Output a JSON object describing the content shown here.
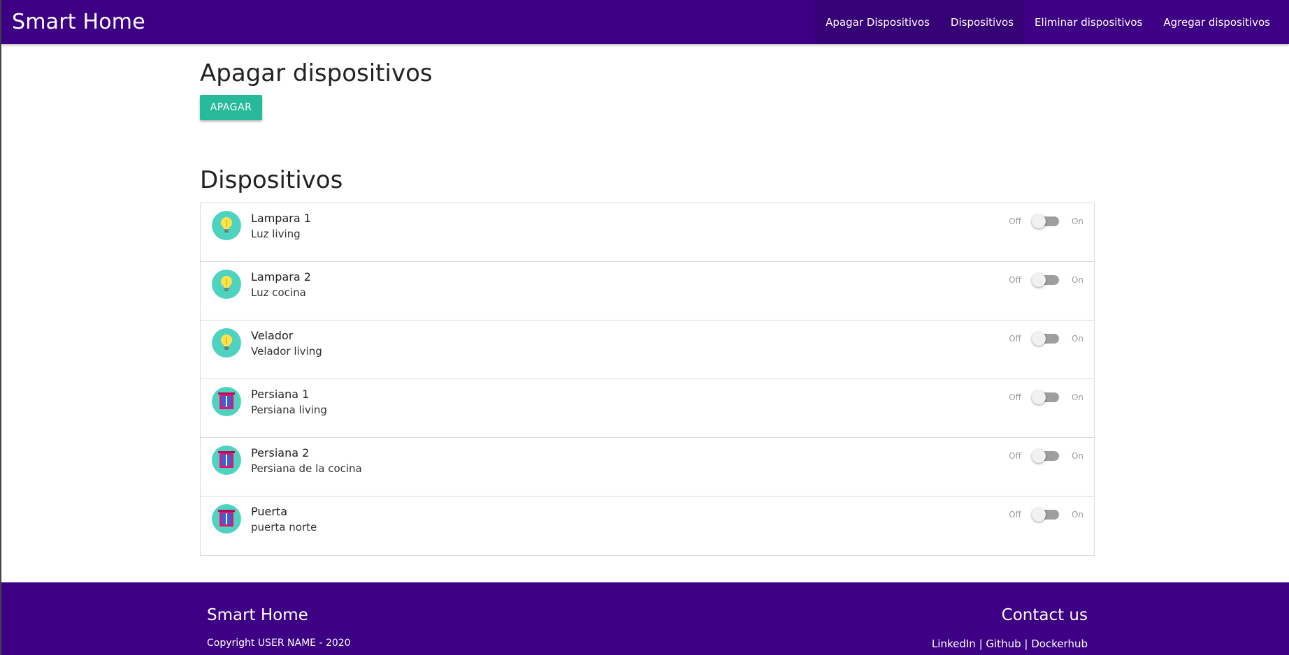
{
  "navbar": {
    "brand": "Smart Home",
    "links": [
      {
        "label": "Apagar Dispositivos"
      },
      {
        "label": "Dispositivos"
      },
      {
        "label": "Eliminar dispositivos"
      },
      {
        "label": "Agregar dispositivos"
      }
    ]
  },
  "apagar": {
    "title": "Apagar dispositivos",
    "button_label": "APAGAR"
  },
  "devices": {
    "title": "Dispositivos",
    "off_label": "Off",
    "on_label": "On",
    "items": [
      {
        "name": "Lampara 1",
        "description": "Luz living",
        "icon": "lightbulb-icon",
        "state": "off"
      },
      {
        "name": "Lampara 2",
        "description": "Luz cocina",
        "icon": "lightbulb-icon",
        "state": "off"
      },
      {
        "name": "Velador",
        "description": "Velador living",
        "icon": "lightbulb-icon",
        "state": "off"
      },
      {
        "name": "Persiana 1",
        "description": "Persiana living",
        "icon": "window-icon",
        "state": "off"
      },
      {
        "name": "Persiana 2",
        "description": "Persiana de la cocina",
        "icon": "window-icon",
        "state": "off"
      },
      {
        "name": "Puerta",
        "description": "puerta norte",
        "icon": "window-icon",
        "state": "off"
      }
    ]
  },
  "footer": {
    "title": "Smart Home",
    "copyright": "Copyright USER NAME - 2020",
    "contact_title": "Contact us",
    "contact_links": [
      "LinkedIn",
      "Github",
      "Dockerhub"
    ],
    "separator": " | "
  },
  "colors": {
    "navbar_bg": "#3d0084",
    "button_bg": "#26b99a",
    "avatar_bg": "#4fd3c1"
  }
}
